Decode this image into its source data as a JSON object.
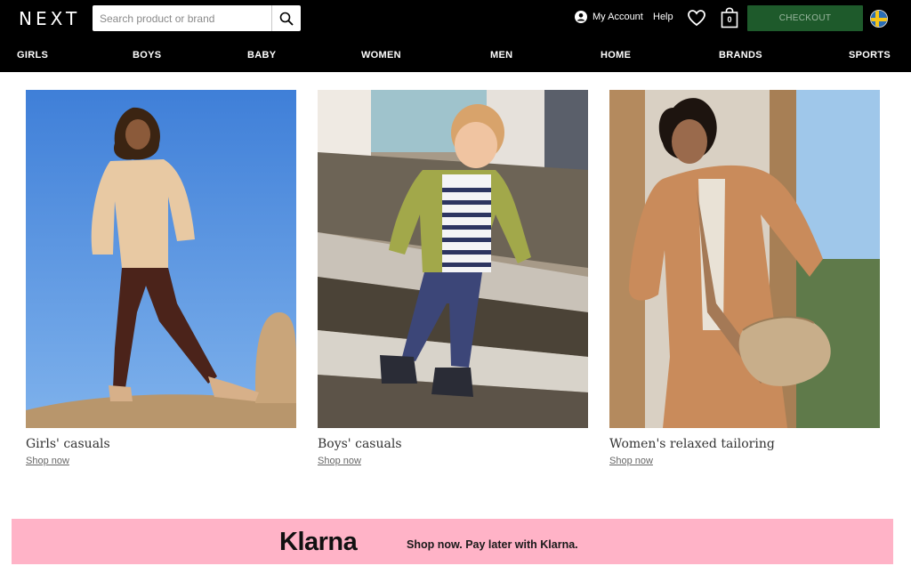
{
  "header": {
    "logo": "NEXT",
    "search_placeholder": "Search product or brand",
    "account_label": "My Account",
    "help_label": "Help",
    "bag_count": "0",
    "checkout_label": "CHECKOUT",
    "checkout_color": "#1e5a2b"
  },
  "nav": {
    "items": [
      "GIRLS",
      "BOYS",
      "BABY",
      "WOMEN",
      "MEN",
      "HOME",
      "BRANDS",
      "SPORTS"
    ]
  },
  "cards": [
    {
      "title": "Girls' casuals",
      "link": "Shop now"
    },
    {
      "title": "Boys' casuals",
      "link": "Shop now"
    },
    {
      "title": "Women's relaxed tailoring",
      "link": "Shop now"
    }
  ],
  "banner": {
    "logo": "Klarna",
    "text": "Shop now. Pay later with Klarna.",
    "color": "#ffb3c7"
  },
  "icons": [
    "search-icon",
    "account-icon",
    "heart-icon",
    "bag-icon",
    "sweden-flag-icon"
  ]
}
